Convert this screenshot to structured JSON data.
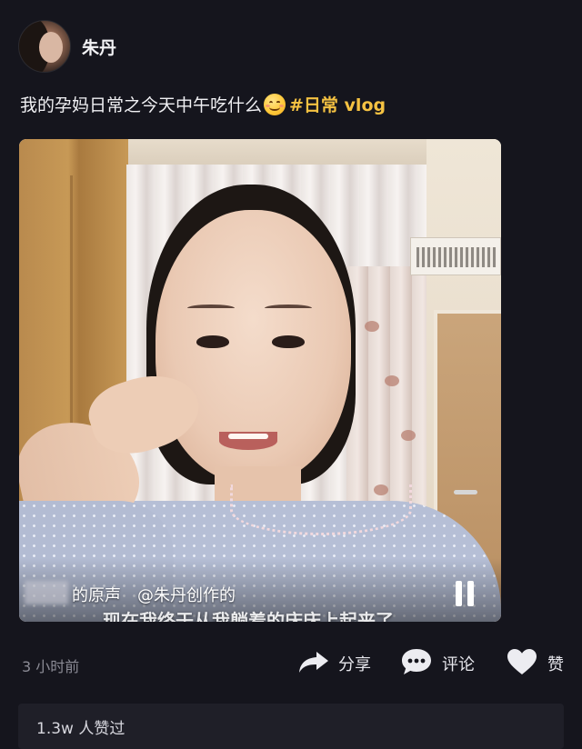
{
  "post": {
    "username": "朱丹",
    "caption_text": "我的孕妈日常之今天中午吃什么",
    "hashtag": "#日常 vlog",
    "time_ago": "3 小时前",
    "likes_summary": "1.3w 人赞过"
  },
  "video": {
    "music_label": "的原声　@朱丹创作的",
    "subtitle": "现在我终于从我躺着的床床上起来了",
    "state": "playing"
  },
  "actions": {
    "share_label": "分享",
    "comment_label": "评论",
    "like_label": "赞"
  },
  "icons": {
    "share": "share-arrow-icon",
    "comment": "comment-bubble-icon",
    "like": "heart-icon",
    "pause": "pause-icon",
    "emoji": "smiling-face-emoji"
  },
  "colors": {
    "background": "#15151d",
    "hashtag": "#f5c242",
    "muted_text": "#8b8b95"
  }
}
